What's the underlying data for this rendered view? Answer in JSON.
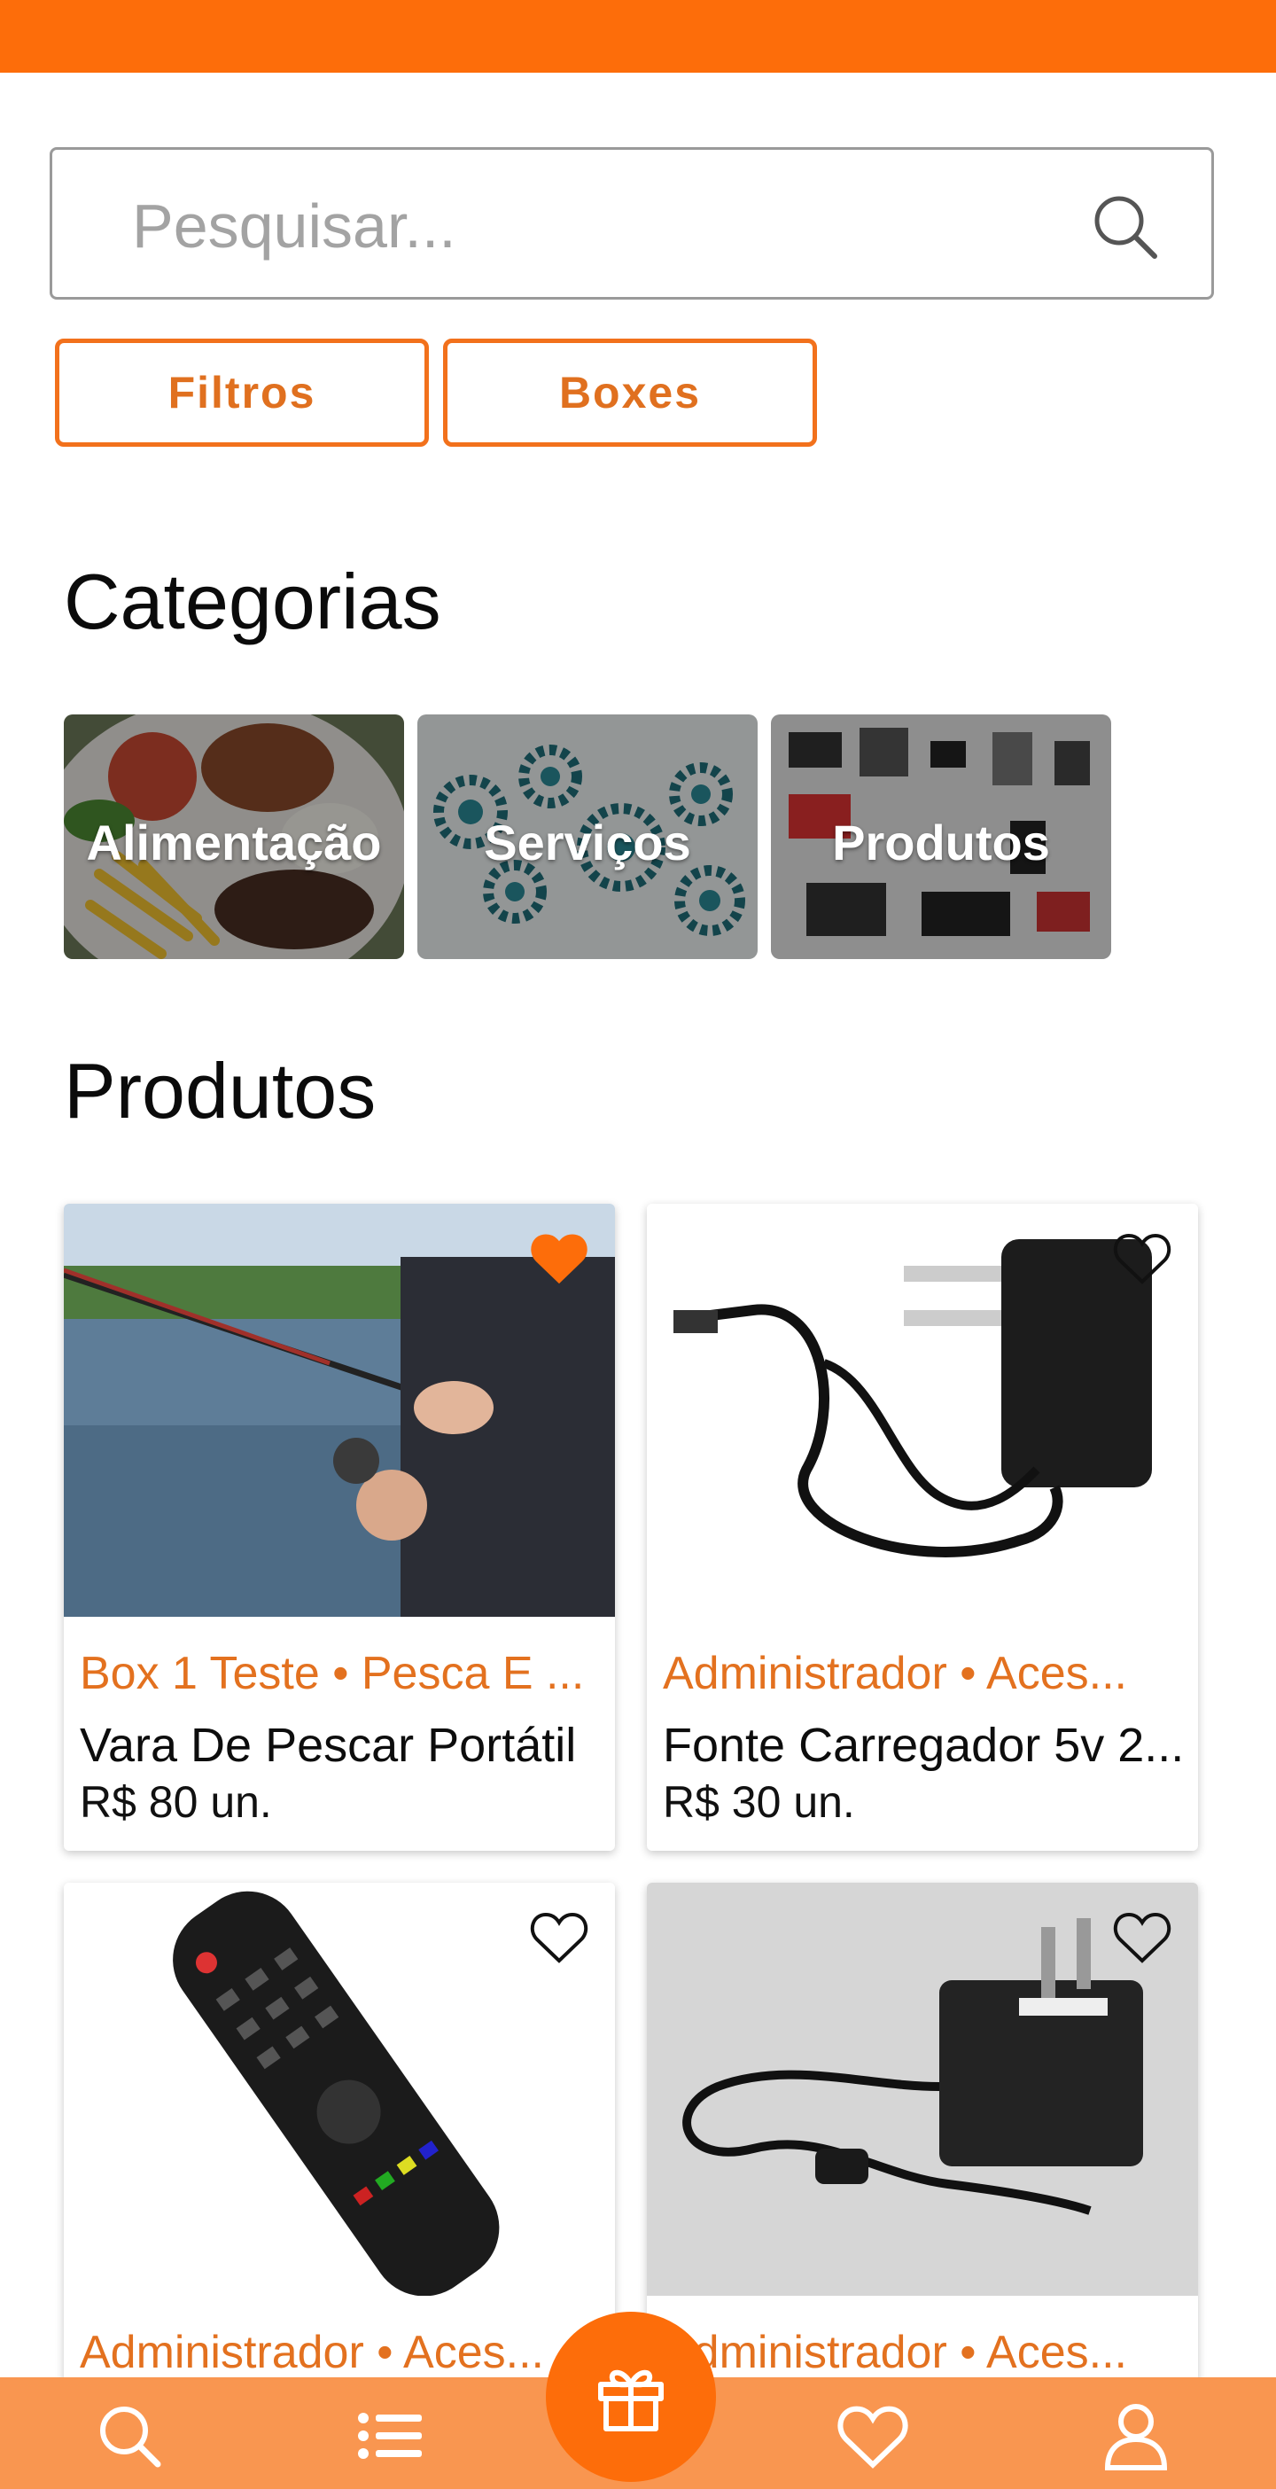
{
  "search": {
    "placeholder": "Pesquisar..."
  },
  "buttons": {
    "filters": "Filtros",
    "boxes": "Boxes"
  },
  "sections": {
    "categories": "Categorias",
    "products": "Produtos"
  },
  "categories": [
    {
      "label": "Alimentação"
    },
    {
      "label": "Serviços"
    },
    {
      "label": "Produtos"
    }
  ],
  "products": [
    {
      "store": "Box 1 Teste • Pesca E ...",
      "name": "Vara De Pescar Portátil",
      "price": "R$ 80 un.",
      "favorite": true
    },
    {
      "store": "Administrador • Aces...",
      "name": "Fonte Carregador 5v 2...",
      "price": "R$ 30 un.",
      "favorite": false
    },
    {
      "store": "Administrador • Aces...",
      "name": "",
      "price": "",
      "favorite": false
    },
    {
      "store": "Administrador • Aces...",
      "name": "",
      "price": "",
      "favorite": false
    }
  ],
  "nav": {
    "icons": [
      "search-icon",
      "list-icon",
      "gift-icon",
      "heart-icon",
      "user-icon"
    ]
  },
  "colors": {
    "accent": "#FD6D0A",
    "accent_text": "#E3711F",
    "bottom_bar": "#F99650"
  }
}
